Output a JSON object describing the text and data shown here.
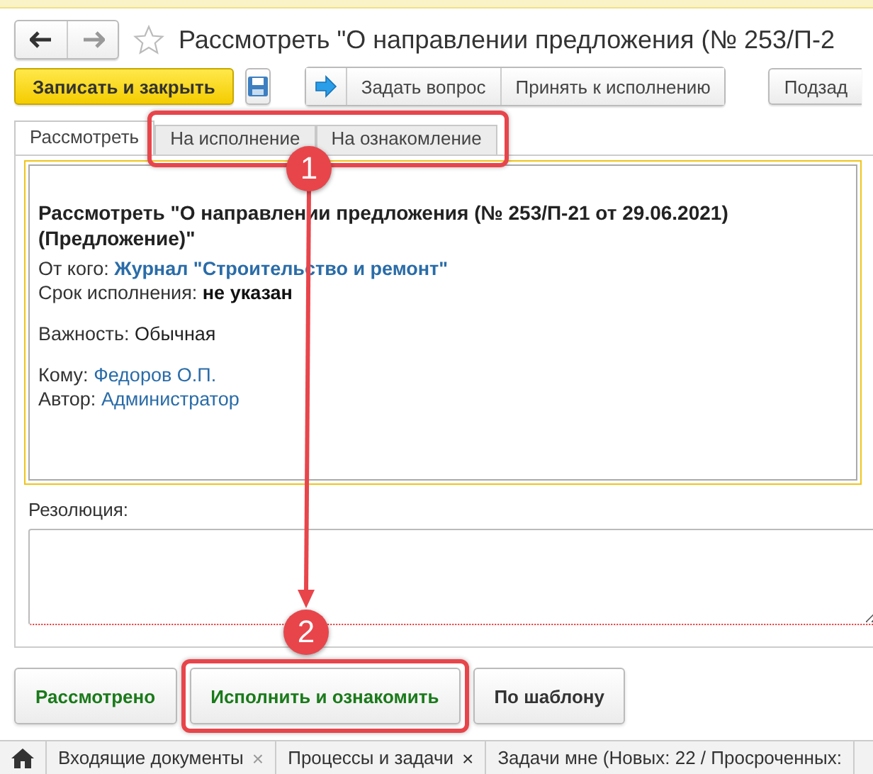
{
  "window": {
    "title": "Рассмотреть \"О направлении предложения (№ 253/П-2"
  },
  "toolbar": {
    "primary": "Записать и закрыть",
    "buttons": [
      "Задать вопрос",
      "Принять к исполнению"
    ],
    "cut_button": "Подзад"
  },
  "tabs": [
    {
      "label": "Рассмотреть",
      "selected": true
    },
    {
      "label": "На исполнение",
      "selected": false
    },
    {
      "label": "На ознакомление",
      "selected": false
    }
  ],
  "task": {
    "heading": "Рассмотреть \"О направлении предложения (№ 253/П-21 от 29.06.2021) (Предложение)\"",
    "groups": [
      [
        {
          "label": "От кого:",
          "value": "Журнал \"Строительство и ремонт\"",
          "kind": "link-bold"
        },
        {
          "label": "Срок исполнения:",
          "value": "не указан",
          "kind": "bold"
        }
      ],
      [
        {
          "label": "Важность:",
          "value": "Обычная",
          "kind": "plain"
        }
      ],
      [
        {
          "label": "Кому:",
          "value": "Федоров О.П.",
          "kind": "link"
        },
        {
          "label": "Автор:",
          "value": "Администратор",
          "kind": "link"
        }
      ]
    ]
  },
  "resolution": {
    "label": "Резолюция:"
  },
  "actions": [
    "Рассмотрено",
    "Исполнить и ознакомить",
    "По шаблону"
  ],
  "taskbar": [
    {
      "label": "Входящие документы",
      "close": "×"
    },
    {
      "label": "Процессы и задачи",
      "close": "×"
    },
    {
      "label": "Задачи мне (Новых: 22 / Просроченных:"
    }
  ],
  "annotations": [
    {
      "number": "1"
    },
    {
      "number": "2"
    }
  ]
}
